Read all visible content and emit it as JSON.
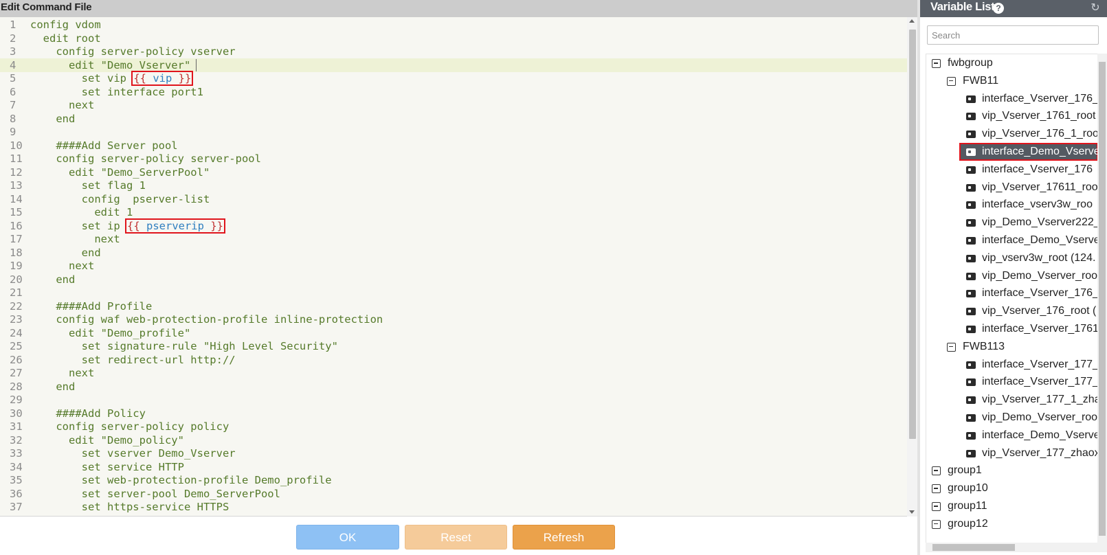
{
  "editor": {
    "title": "Edit Command File",
    "lines": [
      {
        "num": "1",
        "text": "config vdom"
      },
      {
        "num": "2",
        "text": "  edit root"
      },
      {
        "num": "3",
        "text": "    config server-policy vserver"
      },
      {
        "num": "4",
        "text": "      edit \"Demo_Vserver\"",
        "active": true
      },
      {
        "num": "5",
        "text": "        set vip ",
        "tpl_open": "{{",
        "tpl_var": " vip ",
        "tpl_close": "}}"
      },
      {
        "num": "6",
        "text": "        set interface port1"
      },
      {
        "num": "7",
        "text": "      next"
      },
      {
        "num": "8",
        "text": "    end"
      },
      {
        "num": "9",
        "text": ""
      },
      {
        "num": "10",
        "text": "    ####Add Server pool"
      },
      {
        "num": "11",
        "text": "    config server-policy server-pool"
      },
      {
        "num": "12",
        "text": "      edit \"Demo_ServerPool\""
      },
      {
        "num": "13",
        "text": "        set flag 1"
      },
      {
        "num": "14",
        "text": "        config  pserver-list"
      },
      {
        "num": "15",
        "text": "          edit 1"
      },
      {
        "num": "16",
        "text": "        set ip ",
        "tpl_open": "{{",
        "tpl_var": " pserverip ",
        "tpl_close": "}}"
      },
      {
        "num": "17",
        "text": "          next"
      },
      {
        "num": "18",
        "text": "        end"
      },
      {
        "num": "19",
        "text": "      next"
      },
      {
        "num": "20",
        "text": "    end"
      },
      {
        "num": "21",
        "text": ""
      },
      {
        "num": "22",
        "text": "    ####Add Profile"
      },
      {
        "num": "23",
        "text": "    config waf web-protection-profile inline-protection"
      },
      {
        "num": "24",
        "text": "      edit \"Demo_profile\""
      },
      {
        "num": "25",
        "text": "        set signature-rule \"High Level Security\""
      },
      {
        "num": "26",
        "text": "        set redirect-url http://"
      },
      {
        "num": "27",
        "text": "      next"
      },
      {
        "num": "28",
        "text": "    end"
      },
      {
        "num": "29",
        "text": ""
      },
      {
        "num": "30",
        "text": "    ####Add Policy"
      },
      {
        "num": "31",
        "text": "    config server-policy policy"
      },
      {
        "num": "32",
        "text": "      edit \"Demo_policy\""
      },
      {
        "num": "33",
        "text": "        set vserver Demo_Vserver"
      },
      {
        "num": "34",
        "text": "        set service HTTP"
      },
      {
        "num": "35",
        "text": "        set web-protection-profile Demo_profile"
      },
      {
        "num": "36",
        "text": "        set server-pool Demo_ServerPool"
      },
      {
        "num": "37",
        "text": "        set https-service HTTPS"
      }
    ]
  },
  "buttons": {
    "ok": "OK",
    "reset": "Reset",
    "refresh": "Refresh"
  },
  "variable_list": {
    "title": "Variable List",
    "help_icon": "?",
    "refresh_icon": "↻",
    "search_placeholder": "Search",
    "tree": [
      {
        "level": 0,
        "kind": "group",
        "label": "fwbgroup"
      },
      {
        "level": 1,
        "kind": "group",
        "label": "FWB11"
      },
      {
        "level": 2,
        "kind": "leaf",
        "label": "interface_Vserver_176_"
      },
      {
        "level": 2,
        "kind": "leaf",
        "label": "vip_Vserver_1761_root"
      },
      {
        "level": 2,
        "kind": "leaf",
        "label": "vip_Vserver_176_1_roo"
      },
      {
        "level": 2,
        "kind": "leaf",
        "label": "interface_Demo_Vserve",
        "selected": true
      },
      {
        "level": 2,
        "kind": "leaf",
        "label": "interface_Vserver_176"
      },
      {
        "level": 2,
        "kind": "leaf",
        "label": "vip_Vserver_17611_roo"
      },
      {
        "level": 2,
        "kind": "leaf",
        "label": "interface_vserv3w_roo"
      },
      {
        "level": 2,
        "kind": "leaf",
        "label": "vip_Demo_Vserver222_"
      },
      {
        "level": 2,
        "kind": "leaf",
        "label": "interface_Demo_Vserve"
      },
      {
        "level": 2,
        "kind": "leaf",
        "label": "vip_vserv3w_root (124."
      },
      {
        "level": 2,
        "kind": "leaf",
        "label": "vip_Demo_Vserver_roo"
      },
      {
        "level": 2,
        "kind": "leaf",
        "label": "interface_Vserver_176_"
      },
      {
        "level": 2,
        "kind": "leaf",
        "label": "vip_Vserver_176_root ("
      },
      {
        "level": 2,
        "kind": "leaf",
        "label": "interface_Vserver_1761"
      },
      {
        "level": 1,
        "kind": "group",
        "label": "FWB113"
      },
      {
        "level": 2,
        "kind": "leaf",
        "label": "interface_Vserver_177_"
      },
      {
        "level": 2,
        "kind": "leaf",
        "label": "interface_Vserver_177_"
      },
      {
        "level": 2,
        "kind": "leaf",
        "label": "vip_Vserver_177_1_zha"
      },
      {
        "level": 2,
        "kind": "leaf",
        "label": "vip_Demo_Vserver_roo"
      },
      {
        "level": 2,
        "kind": "leaf",
        "label": "interface_Demo_Vserve"
      },
      {
        "level": 2,
        "kind": "leaf",
        "label": "vip_Vserver_177_zhaox"
      },
      {
        "level": 0,
        "kind": "group",
        "label": "group1"
      },
      {
        "level": 0,
        "kind": "group",
        "label": "group10"
      },
      {
        "level": 0,
        "kind": "group",
        "label": "group11"
      },
      {
        "level": 0,
        "kind": "group",
        "label": "group12"
      }
    ]
  },
  "colors": {
    "code_text": "#557a2a",
    "template_brace": "#c03030",
    "template_variable": "#2f7fc0",
    "highlight_box": "#e0141c",
    "ok_button": "#8ec1f4",
    "reset_button": "#f5cb9a",
    "refresh_button": "#eba24b",
    "variable_header": "#5a6068"
  }
}
